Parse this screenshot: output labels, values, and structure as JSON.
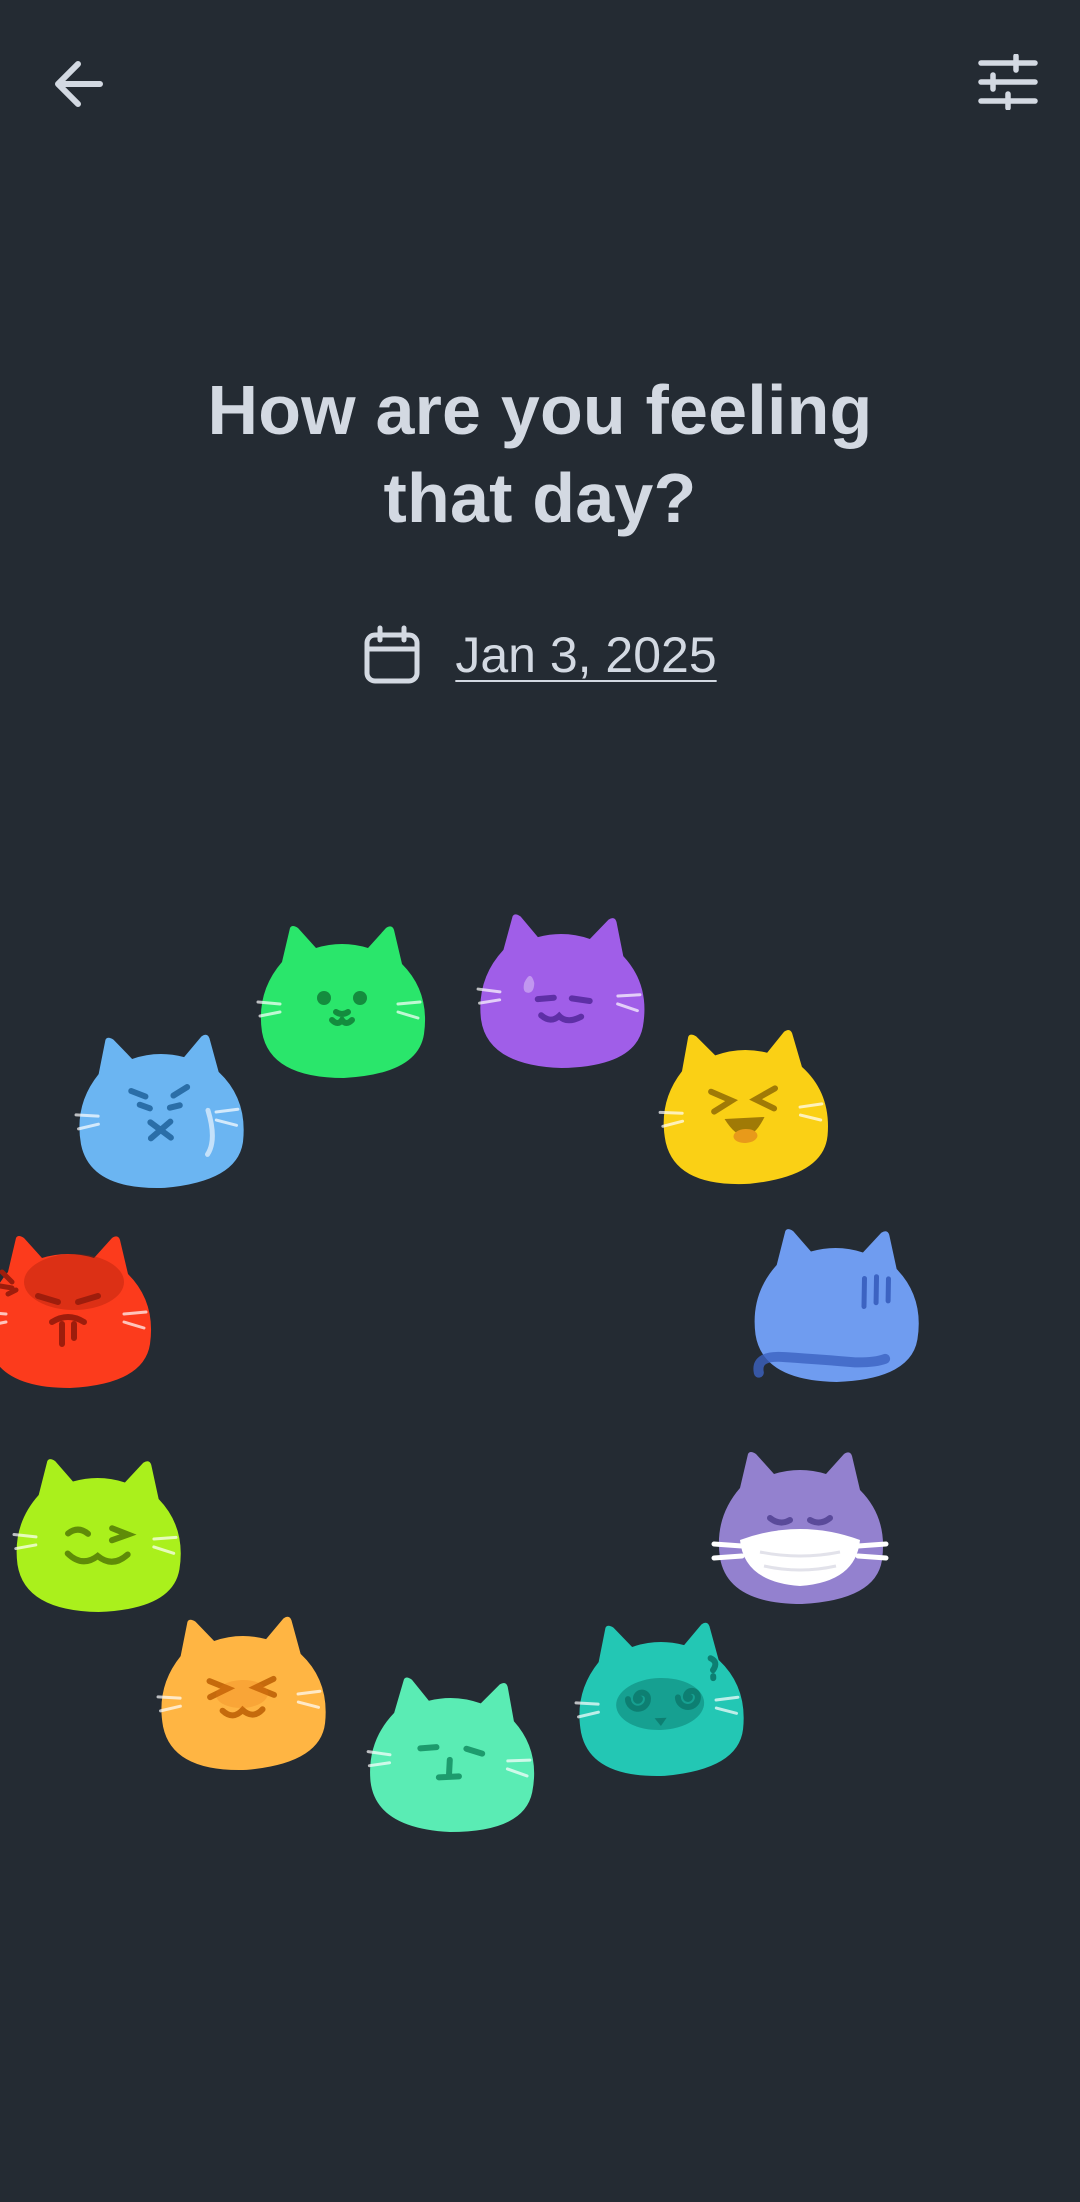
{
  "header": {
    "back_icon": "arrow-left-icon",
    "settings_icon": "sliders-icon"
  },
  "title_lines": [
    "How are you feeling",
    "that day?"
  ],
  "date": {
    "icon": "calendar-icon",
    "label": "Jan 3, 2025"
  },
  "moods": [
    {
      "id": "calm",
      "color": "#2ae66b",
      "dark": "#148c3e",
      "face": "calm"
    },
    {
      "id": "awkward",
      "color": "#a05ee8",
      "dark": "#5e2fa6",
      "face": "sweat"
    },
    {
      "id": "laughing",
      "color": "#fad015",
      "dark": "#a07a06",
      "face": "laugh"
    },
    {
      "id": "tired",
      "color": "#6f9cf0",
      "dark": "#3c63c2",
      "face": "back"
    },
    {
      "id": "sick",
      "color": "#9381cf",
      "dark": "#5a4a9a",
      "face": "mask"
    },
    {
      "id": "dizzy",
      "color": "#23c7b4",
      "dark": "#0d7f72",
      "face": "dizzy"
    },
    {
      "id": "meh",
      "color": "#5aecb4",
      "dark": "#1d9b6d",
      "face": "meh"
    },
    {
      "id": "happy",
      "color": "#ffb543",
      "dark": "#c56a0c",
      "face": "happy"
    },
    {
      "id": "playful",
      "color": "#aaf01c",
      "dark": "#5f8c08",
      "face": "wink"
    },
    {
      "id": "angry",
      "color": "#fc3b1c",
      "dark": "#9e1d0c",
      "face": "angry"
    },
    {
      "id": "sad",
      "color": "#6bb5f2",
      "dark": "#2a6ea8",
      "face": "sad"
    }
  ]
}
